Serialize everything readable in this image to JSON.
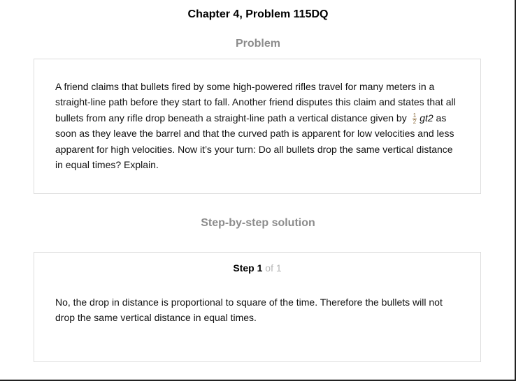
{
  "page_title": "Chapter 4, Problem 115DQ",
  "problem": {
    "heading": "Problem",
    "text_before_fraction": "A friend claims that bullets fired by some high-powered rifles travel for many meters in a straight-line path before they start to fall. Another friend disputes this claim and states that all bullets from any rifle drop beneath a straight-line path a vertical distance given by",
    "fraction_numerator": "1",
    "fraction_denominator": "2",
    "expression": "gt2",
    "text_after_expression": "as soon as they leave the barrel and that the curved path is apparent for low velocities and less apparent for high velocities. Now it’s your turn: Do all bullets drop the same vertical distance in equal times? Explain."
  },
  "solution": {
    "heading": "Step-by-step solution",
    "step_word": "Step",
    "step_number": "1",
    "step_total": "of 1",
    "step_text": "No, the drop in distance is proportional to square of the time. Therefore the bullets will not drop the same vertical distance in equal times."
  }
}
